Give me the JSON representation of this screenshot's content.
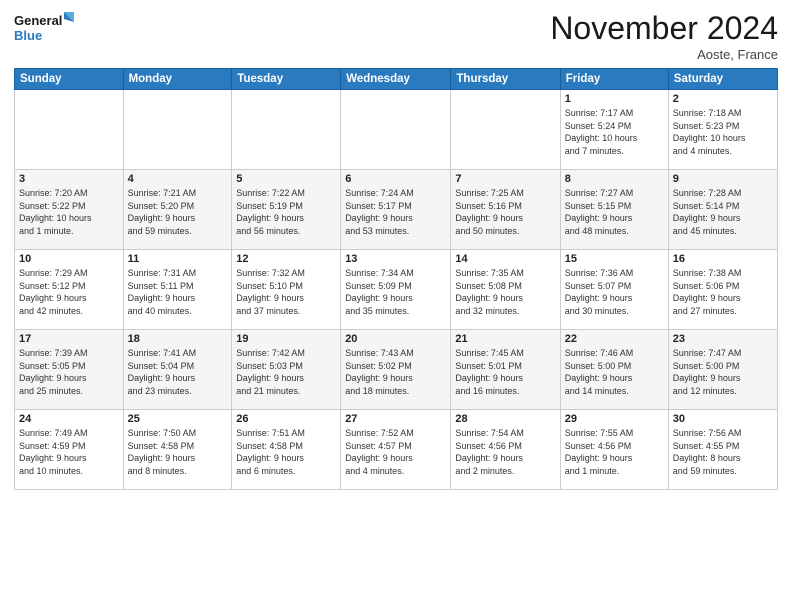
{
  "logo": {
    "line1": "General",
    "line2": "Blue"
  },
  "title": "November 2024",
  "location": "Aoste, France",
  "weekdays": [
    "Sunday",
    "Monday",
    "Tuesday",
    "Wednesday",
    "Thursday",
    "Friday",
    "Saturday"
  ],
  "weeks": [
    [
      {
        "day": "",
        "info": ""
      },
      {
        "day": "",
        "info": ""
      },
      {
        "day": "",
        "info": ""
      },
      {
        "day": "",
        "info": ""
      },
      {
        "day": "",
        "info": ""
      },
      {
        "day": "1",
        "info": "Sunrise: 7:17 AM\nSunset: 5:24 PM\nDaylight: 10 hours\nand 7 minutes."
      },
      {
        "day": "2",
        "info": "Sunrise: 7:18 AM\nSunset: 5:23 PM\nDaylight: 10 hours\nand 4 minutes."
      }
    ],
    [
      {
        "day": "3",
        "info": "Sunrise: 7:20 AM\nSunset: 5:22 PM\nDaylight: 10 hours\nand 1 minute."
      },
      {
        "day": "4",
        "info": "Sunrise: 7:21 AM\nSunset: 5:20 PM\nDaylight: 9 hours\nand 59 minutes."
      },
      {
        "day": "5",
        "info": "Sunrise: 7:22 AM\nSunset: 5:19 PM\nDaylight: 9 hours\nand 56 minutes."
      },
      {
        "day": "6",
        "info": "Sunrise: 7:24 AM\nSunset: 5:17 PM\nDaylight: 9 hours\nand 53 minutes."
      },
      {
        "day": "7",
        "info": "Sunrise: 7:25 AM\nSunset: 5:16 PM\nDaylight: 9 hours\nand 50 minutes."
      },
      {
        "day": "8",
        "info": "Sunrise: 7:27 AM\nSunset: 5:15 PM\nDaylight: 9 hours\nand 48 minutes."
      },
      {
        "day": "9",
        "info": "Sunrise: 7:28 AM\nSunset: 5:14 PM\nDaylight: 9 hours\nand 45 minutes."
      }
    ],
    [
      {
        "day": "10",
        "info": "Sunrise: 7:29 AM\nSunset: 5:12 PM\nDaylight: 9 hours\nand 42 minutes."
      },
      {
        "day": "11",
        "info": "Sunrise: 7:31 AM\nSunset: 5:11 PM\nDaylight: 9 hours\nand 40 minutes."
      },
      {
        "day": "12",
        "info": "Sunrise: 7:32 AM\nSunset: 5:10 PM\nDaylight: 9 hours\nand 37 minutes."
      },
      {
        "day": "13",
        "info": "Sunrise: 7:34 AM\nSunset: 5:09 PM\nDaylight: 9 hours\nand 35 minutes."
      },
      {
        "day": "14",
        "info": "Sunrise: 7:35 AM\nSunset: 5:08 PM\nDaylight: 9 hours\nand 32 minutes."
      },
      {
        "day": "15",
        "info": "Sunrise: 7:36 AM\nSunset: 5:07 PM\nDaylight: 9 hours\nand 30 minutes."
      },
      {
        "day": "16",
        "info": "Sunrise: 7:38 AM\nSunset: 5:06 PM\nDaylight: 9 hours\nand 27 minutes."
      }
    ],
    [
      {
        "day": "17",
        "info": "Sunrise: 7:39 AM\nSunset: 5:05 PM\nDaylight: 9 hours\nand 25 minutes."
      },
      {
        "day": "18",
        "info": "Sunrise: 7:41 AM\nSunset: 5:04 PM\nDaylight: 9 hours\nand 23 minutes."
      },
      {
        "day": "19",
        "info": "Sunrise: 7:42 AM\nSunset: 5:03 PM\nDaylight: 9 hours\nand 21 minutes."
      },
      {
        "day": "20",
        "info": "Sunrise: 7:43 AM\nSunset: 5:02 PM\nDaylight: 9 hours\nand 18 minutes."
      },
      {
        "day": "21",
        "info": "Sunrise: 7:45 AM\nSunset: 5:01 PM\nDaylight: 9 hours\nand 16 minutes."
      },
      {
        "day": "22",
        "info": "Sunrise: 7:46 AM\nSunset: 5:00 PM\nDaylight: 9 hours\nand 14 minutes."
      },
      {
        "day": "23",
        "info": "Sunrise: 7:47 AM\nSunset: 5:00 PM\nDaylight: 9 hours\nand 12 minutes."
      }
    ],
    [
      {
        "day": "24",
        "info": "Sunrise: 7:49 AM\nSunset: 4:59 PM\nDaylight: 9 hours\nand 10 minutes."
      },
      {
        "day": "25",
        "info": "Sunrise: 7:50 AM\nSunset: 4:58 PM\nDaylight: 9 hours\nand 8 minutes."
      },
      {
        "day": "26",
        "info": "Sunrise: 7:51 AM\nSunset: 4:58 PM\nDaylight: 9 hours\nand 6 minutes."
      },
      {
        "day": "27",
        "info": "Sunrise: 7:52 AM\nSunset: 4:57 PM\nDaylight: 9 hours\nand 4 minutes."
      },
      {
        "day": "28",
        "info": "Sunrise: 7:54 AM\nSunset: 4:56 PM\nDaylight: 9 hours\nand 2 minutes."
      },
      {
        "day": "29",
        "info": "Sunrise: 7:55 AM\nSunset: 4:56 PM\nDaylight: 9 hours\nand 1 minute."
      },
      {
        "day": "30",
        "info": "Sunrise: 7:56 AM\nSunset: 4:55 PM\nDaylight: 8 hours\nand 59 minutes."
      }
    ]
  ]
}
